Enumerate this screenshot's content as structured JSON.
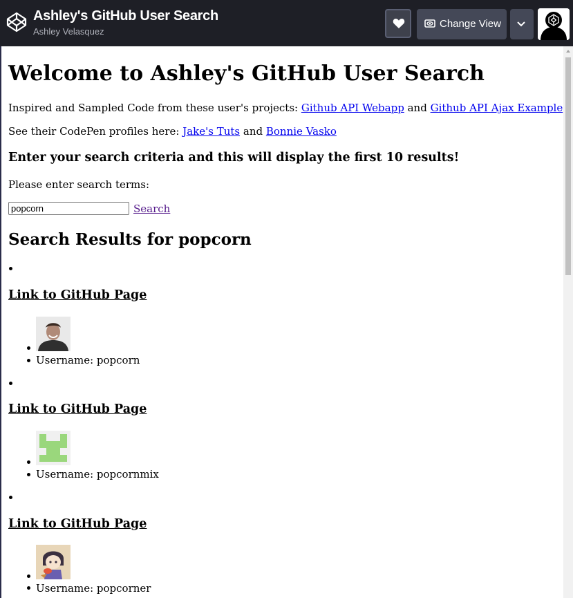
{
  "header": {
    "title": "Ashley's GitHub User Search",
    "author": "Ashley Velasquez",
    "change_view_label": "Change View",
    "icons": [
      "codepen-logo-icon",
      "heart-icon",
      "eye-icon",
      "chevron-down-icon",
      "codepen-avatar-icon"
    ]
  },
  "page": {
    "heading": "Welcome to Ashley's GitHub User Search",
    "credits_prefix": "Inspired and Sampled Code from these user's projects:",
    "credits_link1": "Github API Webapp",
    "credits_and": "and",
    "credits_link2": "Github API Ajax Example",
    "profiles_prefix": "See their CodePen profiles here:",
    "profiles_link1": "Jake's Tuts",
    "profiles_and": "and",
    "profiles_link2": "Bonnie Vasko",
    "instructions": "Enter your search criteria and this will display the first 10 results!",
    "prompt": "Please enter search terms:",
    "search_value": "popcorn",
    "search_link": "Search",
    "results_heading": "Search Results for popcorn"
  },
  "results": [
    {
      "link": "Link to GitHub Page",
      "username": "Username: popcorn"
    },
    {
      "link": "Link to GitHub Page",
      "username": "Username: popcornmix"
    },
    {
      "link": "Link to GitHub Page",
      "username": "Username: popcorner"
    }
  ]
}
